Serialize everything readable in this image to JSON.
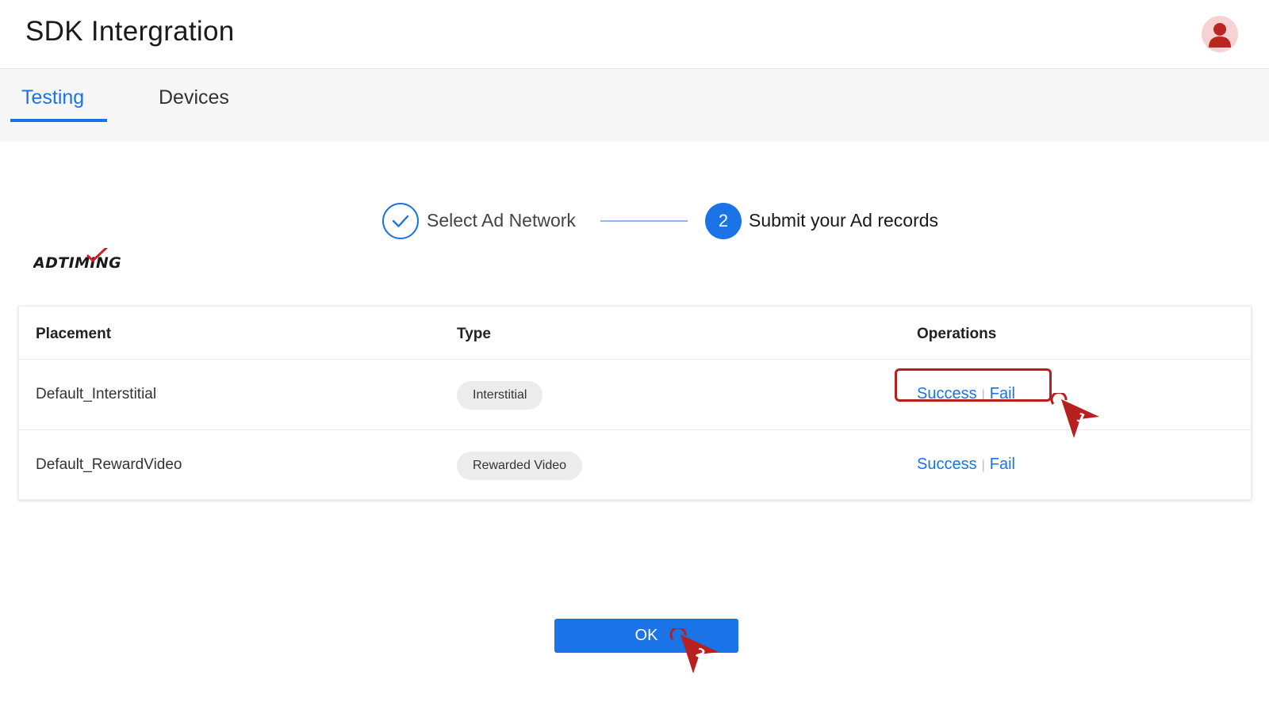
{
  "header": {
    "title": "SDK Intergration"
  },
  "tabs": [
    {
      "label": "Testing",
      "active": true
    },
    {
      "label": "Devices",
      "active": false
    }
  ],
  "steps": [
    {
      "label": "Select Ad Network",
      "status": "done"
    },
    {
      "number": "2",
      "label": "Submit your Ad records",
      "status": "current"
    }
  ],
  "logo": {
    "text": "ADTIMING"
  },
  "table": {
    "columns": [
      "Placement",
      "Type",
      "Operations"
    ],
    "rows": [
      {
        "placement": "Default_Interstitial",
        "type": "Interstitial",
        "success": "Success",
        "fail": "Fail"
      },
      {
        "placement": "Default_RewardVideo",
        "type": "Rewarded Video",
        "success": "Success",
        "fail": "Fail"
      }
    ]
  },
  "ok_button": {
    "label": "OK"
  },
  "annotations": [
    {
      "number": "1"
    },
    {
      "number": "2"
    }
  ],
  "colors": {
    "accent": "#1b73e8",
    "annotation": "#b81f1f"
  }
}
